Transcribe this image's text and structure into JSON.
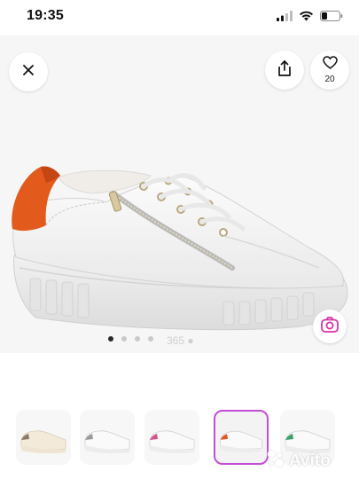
{
  "status_bar": {
    "time": "19:35",
    "icons": [
      "signal-icon",
      "wifi-icon",
      "battery-icon"
    ]
  },
  "header": {
    "close_icon": "close-icon",
    "share_icon": "share-icon",
    "favorite_icon": "heart-icon",
    "favorite_count": "20"
  },
  "gallery": {
    "photo_count": 4,
    "active_index": 0,
    "camera_icon": "camera-icon"
  },
  "thumbnails": [
    {
      "name": "thumb-beige",
      "accent": "#8a7a6b",
      "sole": "#efe4d2"
    },
    {
      "name": "thumb-white",
      "accent": "#9a9a9a",
      "sole": "#ececec"
    },
    {
      "name": "thumb-pink",
      "accent": "#d2548c",
      "sole": "#ededed"
    },
    {
      "name": "thumb-orange",
      "accent": "#e1571f",
      "sole": "#ececec",
      "selected": true
    },
    {
      "name": "thumb-green",
      "accent": "#3aa06a",
      "sole": "#ececec"
    }
  ],
  "watermark": "Avito",
  "colors": {
    "accent_orange": "#e25a1c",
    "selected_border": "#c44dd8",
    "camera_icon": "#d633a8"
  }
}
